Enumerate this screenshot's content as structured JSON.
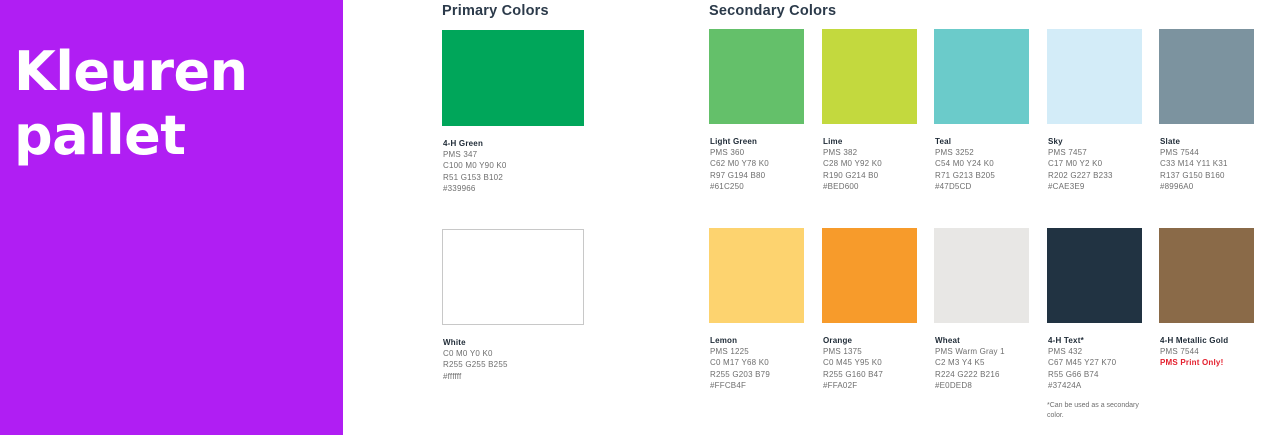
{
  "left_panel": {
    "color": "#b01ef3",
    "title_lines": [
      "Kleuren",
      "pallet"
    ]
  },
  "primary": {
    "heading": "Primary Colors",
    "swatches": [
      {
        "name": "4-H Green",
        "lines": [
          "PMS 347",
          "C100 M0 Y90 K0",
          "R51 G153 B102",
          "#339966"
        ],
        "color": "#00a65a",
        "border": false
      },
      {
        "name": "White",
        "lines": [
          "C0 M0 Y0 K0",
          "R255 G255 B255",
          "#ffffff"
        ],
        "color": "#ffffff",
        "border": true
      }
    ]
  },
  "secondary": {
    "heading": "Secondary Colors",
    "swatches": [
      {
        "name": "Light Green",
        "lines": [
          "PMS 360",
          "C62 M0 Y78 K0",
          "R97 G194 B80",
          "#61C250"
        ],
        "color": "#64c06a"
      },
      {
        "name": "Lime",
        "lines": [
          "PMS 382",
          "C28 M0 Y92 K0",
          "R190 G214 B0",
          "#BED600"
        ],
        "color": "#c3d93e"
      },
      {
        "name": "Teal",
        "lines": [
          "PMS 3252",
          "C54 M0 Y24 K0",
          "R71 G213 B205",
          "#47D5CD"
        ],
        "color": "#6bcbca"
      },
      {
        "name": "Sky",
        "lines": [
          "PMS 7457",
          "C17 M0 Y2 K0",
          "R202 G227 B233",
          "#CAE3E9"
        ],
        "color": "#d3ecf8"
      },
      {
        "name": "Slate",
        "lines": [
          "PMS 7544",
          "C33 M14 Y11 K31",
          "R137 G150 B160",
          "#8996A0"
        ],
        "color": "#7c939f"
      },
      {
        "name": "Lemon",
        "lines": [
          "PMS 1225",
          "C0 M17 Y68 K0",
          "R255 G203 B79",
          "#FFCB4F"
        ],
        "color": "#fdd36f"
      },
      {
        "name": "Orange",
        "lines": [
          "PMS 1375",
          "C0 M45 Y95 K0",
          "R255 G160 B47",
          "#FFA02F"
        ],
        "color": "#f79b2b"
      },
      {
        "name": "Wheat",
        "lines": [
          "PMS Warm Gray 1",
          "C2 M3 Y4 K5",
          "R224 G222 B216",
          "#E0DED8"
        ],
        "color": "#e8e7e5"
      },
      {
        "name": "4-H Text*",
        "lines": [
          "PMS 432",
          "C67 M45 Y27 K70",
          "R55 G66 B74",
          "#37424A"
        ],
        "color": "#213342"
      },
      {
        "name": "4-H Metallic Gold",
        "lines": [
          "PMS 7544"
        ],
        "warning": "PMS Print Only!",
        "color": "#8a6a48"
      }
    ]
  },
  "note": "*Can be used as a secondary color."
}
